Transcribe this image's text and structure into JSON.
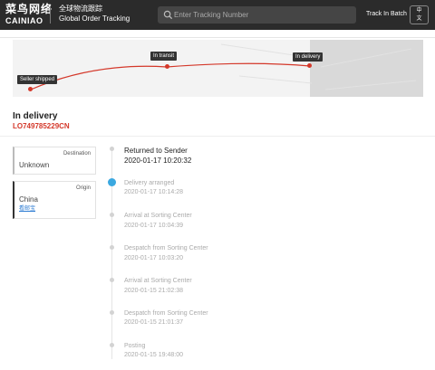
{
  "header": {
    "logo_cn": "菜鸟网络",
    "logo_en": "CAINIAO",
    "subtitle_cn": "全球物流跟踪",
    "subtitle_en": "Global Order Tracking",
    "search_placeholder": "Enter Tracking Number",
    "batch_label": "Track In Batch",
    "lang_line1": "中",
    "lang_line2": "文"
  },
  "map": {
    "tags": {
      "seller": "Seller shipped",
      "transit": "In transit",
      "delivery": "In delivery"
    },
    "route_color": "#d4382a"
  },
  "status": {
    "title": "In delivery",
    "tracking_number": "LO749785229CN"
  },
  "destination": {
    "label": "Destination",
    "value": "Unknown"
  },
  "origin": {
    "label": "Origin",
    "value": "China",
    "carrier": "看邮宝"
  },
  "events": [
    {
      "status": "Returned to Sender",
      "time": "2020-01-17 10:20:32"
    },
    {
      "status": "Delivery arranged",
      "time": "2020-01-17 10:14:28"
    },
    {
      "status": "Arrival at Sorting Center",
      "time": "2020-01-17 10:04:39"
    },
    {
      "status": "Despatch from Sorting Center",
      "time": "2020-01-17 10:03:20"
    },
    {
      "status": "Arrival at Sorting Center",
      "time": "2020-01-15 21:02:38"
    },
    {
      "status": "Despatch from Sorting Center",
      "time": "2020-01-15 21:01:37"
    },
    {
      "status": "Posting",
      "time": "2020-01-15 19:48:00"
    }
  ]
}
